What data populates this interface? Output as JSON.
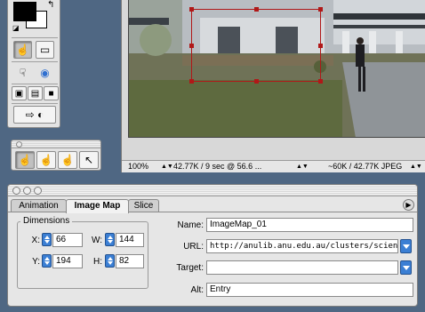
{
  "tools": {
    "colors": {
      "foreground": "#000000",
      "background": "#ffffff"
    },
    "buttons": [
      {
        "name": "hand-tool",
        "icon": "hand-icon",
        "glyph": "☝",
        "active": true
      },
      {
        "name": "slice-tool",
        "icon": "slice-icon",
        "glyph": "▭",
        "active": false
      },
      {
        "name": "pointer-hand-tool",
        "icon": "pointer-hand-icon",
        "glyph": "☟",
        "active": false
      },
      {
        "name": "web-tool",
        "icon": "globe-icon",
        "glyph": "◉",
        "active": false
      },
      {
        "name": "mode-standard",
        "icon": "standard-mode-icon",
        "glyph": "▣",
        "active": false
      },
      {
        "name": "mode-full",
        "icon": "full-screen-icon",
        "glyph": "▤",
        "active": false
      },
      {
        "name": "mode-full-menu",
        "icon": "full-screen-menu-icon",
        "glyph": "■",
        "active": false
      },
      {
        "name": "jump-to-app",
        "icon": "jump-icon",
        "glyph": "⇨",
        "active": false
      }
    ]
  },
  "hand_palette": {
    "icons": [
      "hand-icon",
      "hand-icon",
      "hand-icon",
      "arrow-hand-icon"
    ]
  },
  "document": {
    "status": {
      "zoom": "100%",
      "info": "42.77K / 9 sec @ 56.6 ...",
      "size": "~60K / 42.77K JPEG"
    }
  },
  "properties": {
    "tabs": [
      "Animation",
      "Image Map",
      "Slice"
    ],
    "active_tab": "Image Map",
    "dimensions_title": "Dimensions",
    "x": {
      "label": "X:",
      "value": "66"
    },
    "y": {
      "label": "Y:",
      "value": "194"
    },
    "w": {
      "label": "W:",
      "value": "144"
    },
    "h": {
      "label": "H:",
      "value": "82"
    },
    "name": {
      "label": "Name:",
      "value": "ImageMap_01"
    },
    "url": {
      "label": "URL:",
      "value": "http://anulib.anu.edu.au/clusters/science/buil"
    },
    "target": {
      "label": "Target:",
      "value": ""
    },
    "alt": {
      "label": "Alt:",
      "value": "Entry"
    },
    "accent": "#3b7fd4"
  }
}
